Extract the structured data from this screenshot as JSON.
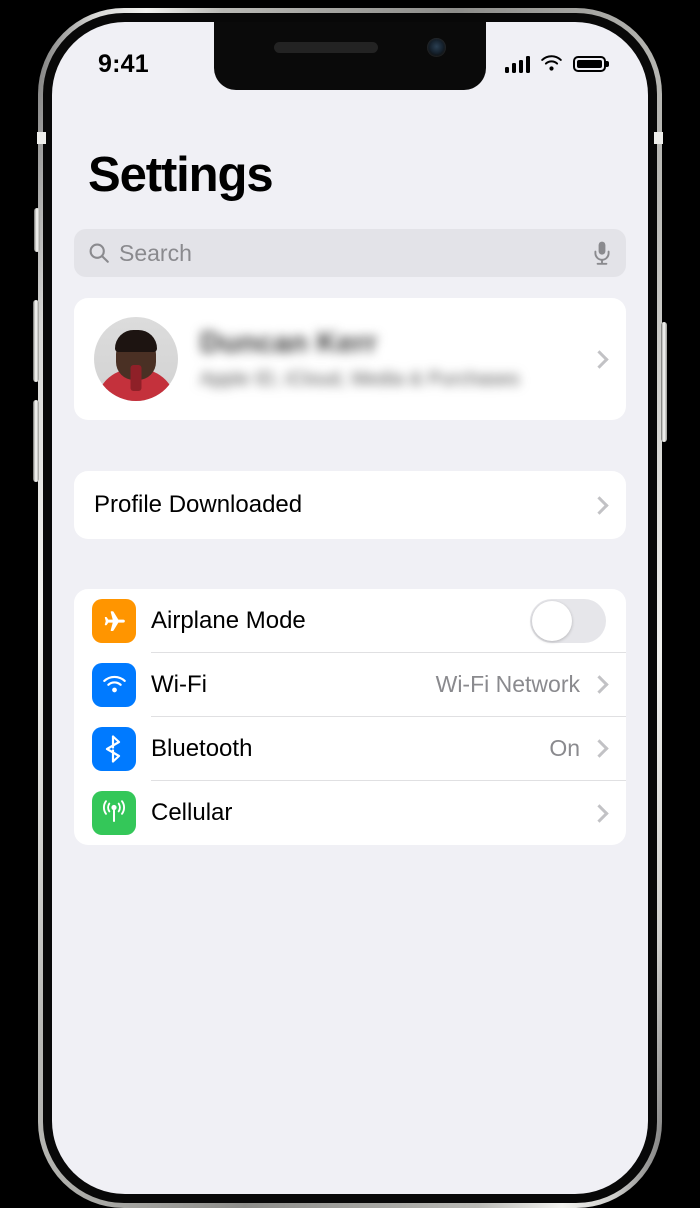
{
  "device": {
    "frame_color": "#b9b9b5",
    "screen_bg": "#F0F0F5",
    "buttons": {
      "mute_switch": "mute-switch",
      "volume_up": "volume-up",
      "volume_down": "volume-down",
      "side_button": "side-button"
    }
  },
  "status_bar": {
    "time": "9:41",
    "signal_bars": 4,
    "wifi": "wifi-icon",
    "battery_level": 100
  },
  "header": {
    "title": "Settings"
  },
  "search": {
    "placeholder": "Search",
    "icon": "search-icon",
    "mic_icon": "microphone-icon",
    "value": "",
    "bg_color": "#E3E3E8"
  },
  "profile": {
    "name": "Duncan Kerr",
    "subtitle": "Apple ID, iCloud, Media & Purchases",
    "avatar": "user-avatar",
    "blurred": true
  },
  "profile_downloaded": {
    "label": "Profile Downloaded"
  },
  "settings_rows": [
    {
      "label": "Airplane Mode",
      "icon": "airplane-icon",
      "icon_color": "#FF9500",
      "control": "toggle",
      "toggle_on": false,
      "value": ""
    },
    {
      "label": "Wi-Fi",
      "icon": "wifi-icon",
      "icon_color": "#007AFF",
      "control": "chevron",
      "value": "Wi-Fi Network"
    },
    {
      "label": "Bluetooth",
      "icon": "bluetooth-icon",
      "icon_color": "#007AFF",
      "control": "chevron",
      "value": "On"
    },
    {
      "label": "Cellular",
      "icon": "cellular-icon",
      "icon_color": "#34C759",
      "control": "chevron",
      "value": ""
    }
  ]
}
